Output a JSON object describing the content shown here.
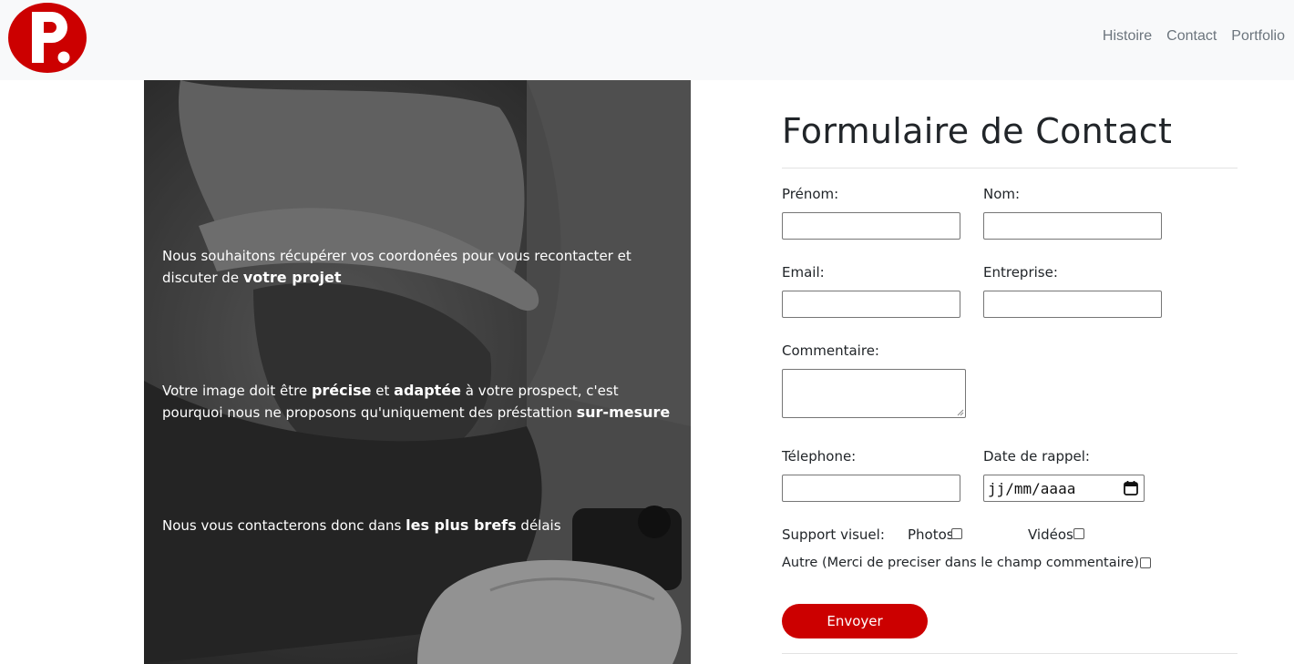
{
  "nav": {
    "logo_alt": "P. logo",
    "links": [
      "Histoire",
      "Contact",
      "Portfolio"
    ]
  },
  "panel": {
    "p1_a": "Nous souhaitons récupérer vos coordonées pour vous recontacter et discuter de ",
    "p1_b": "votre projet",
    "p2_a": "Votre image doit être ",
    "p2_b": "précise",
    "p2_c": " et ",
    "p2_d": "adaptée",
    "p2_e": " à votre prospect, c'est pourquoi nous ne proposons qu'uniquement des préstattion ",
    "p2_f": "sur-mesure",
    "p3_a": "Nous vous contacterons donc dans ",
    "p3_b": "les plus brefs",
    "p3_c": " délais"
  },
  "form": {
    "title": "Formulaire de Contact",
    "prenom_label": "Prénom:",
    "nom_label": "Nom:",
    "email_label": "Email:",
    "entreprise_label": "Entreprise:",
    "commentaire_label": "Commentaire:",
    "telephone_label": "Télephone:",
    "date_label": "Date de rappel:",
    "date_placeholder": "jj/mm/aaaa",
    "support_label": "Support visuel:",
    "photos_label": "Photos",
    "videos_label": "Vidéos",
    "autre_label": "Autre (Merci de preciser dans le champ commentaire)",
    "submit_label": "Envoyer"
  },
  "colors": {
    "brand_red": "#cc0000",
    "navbar_bg": "#f8f9fa",
    "nav_link": "#6c757d"
  }
}
